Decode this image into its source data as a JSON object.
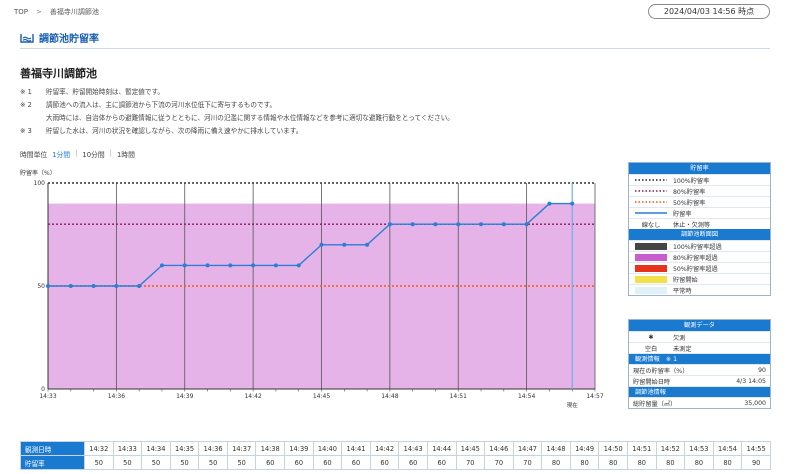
{
  "breadcrumb": {
    "home": "TOP",
    "separator": ">",
    "current": "善福寺川調節池"
  },
  "timestamp": "2024/04/03 14:56 時点",
  "section": {
    "title": "調節池貯留率",
    "icon": "water-gauge-icon"
  },
  "page_title": "善福寺川調節池",
  "notes": [
    {
      "num": "※ 1",
      "lines": [
        "貯留率、貯留開始時刻は、暫定値です。"
      ]
    },
    {
      "num": "※ 2",
      "lines": [
        "調節池への流入は、主に調節池から下流の河川水位低下に寄与するものです。",
        "大雨時には、自治体からの避難情報に従うとともに、河川の氾濫に関する情報や水位情報などを参考に適切な避難行動をとってください。"
      ]
    },
    {
      "num": "※ 3",
      "lines": [
        "貯留した水は、河川の状況を確認しながら、次の降雨に備え速やかに排水しています。"
      ]
    }
  ],
  "time_unit": {
    "label": "時間単位",
    "options": [
      "1分間",
      "10分間",
      "1時間"
    ],
    "selected": "1分間"
  },
  "chart_data": {
    "type": "line",
    "ylabel": "貯留率（%）",
    "ylim": [
      0,
      100
    ],
    "y_ticks": [
      "0",
      "50",
      "100"
    ],
    "x_tick_labels": [
      "14:33",
      "14:36",
      "14:39",
      "14:42",
      "14:45",
      "14:48",
      "14:51",
      "14:54",
      "14:57"
    ],
    "x_range": [
      "14:33",
      "14:57"
    ],
    "now_label": "現在",
    "now_time": "14:56",
    "x": [
      "14:33",
      "14:34",
      "14:35",
      "14:36",
      "14:37",
      "14:38",
      "14:39",
      "14:40",
      "14:41",
      "14:42",
      "14:43",
      "14:44",
      "14:45",
      "14:46",
      "14:47",
      "14:48",
      "14:49",
      "14:50",
      "14:51",
      "14:52",
      "14:53",
      "14:54",
      "14:55",
      "14:56"
    ],
    "values": [
      50,
      50,
      50,
      50,
      50,
      60,
      60,
      60,
      60,
      60,
      60,
      60,
      70,
      70,
      70,
      80,
      80,
      80,
      80,
      80,
      80,
      80,
      90,
      90
    ],
    "reference_lines": [
      {
        "label": "100%貯留率",
        "value": 100,
        "color": "#333333"
      },
      {
        "label": "80%貯留率",
        "value": 80,
        "color": "#8b1a4f"
      },
      {
        "label": "50%貯留率",
        "value": 50,
        "color": "#f05a14"
      }
    ],
    "band": {
      "label": "80%貯留率超過",
      "from": 0,
      "to": 90,
      "color": "#e6b3e8"
    },
    "line_color": "#2a7fd4",
    "grid": true
  },
  "legend": {
    "title": "貯留率",
    "items": [
      {
        "style": "dotted",
        "color": "#222222",
        "label": "100%貯留率"
      },
      {
        "style": "dotted",
        "color": "#8b1a4f",
        "label": "80%貯留率"
      },
      {
        "style": "dotted",
        "color": "#f05a14",
        "label": "50%貯留率"
      },
      {
        "style": "solid",
        "color": "#2a7fd4",
        "label": "貯留率"
      },
      {
        "style": "text",
        "text": "線なし",
        "label": "休止・欠測等"
      }
    ],
    "section_title": "調節池断面図",
    "swatches": [
      {
        "color": "#454545",
        "label": "100%貯留率超過"
      },
      {
        "color": "#c85dcf",
        "label": "80%貯留率超過"
      },
      {
        "color": "#e8331c",
        "label": "50%貯留率超過"
      },
      {
        "color": "#f2e14a",
        "label": "貯留開始"
      },
      {
        "color": "#e0f1f8",
        "label": "平常時"
      }
    ]
  },
  "observation": {
    "title": "観測データ",
    "rows": [
      {
        "symbol": "✱",
        "label": "欠測"
      },
      {
        "symbol": "空白",
        "label": "未測定"
      }
    ],
    "info_title": "観測情報　※ 1",
    "info": [
      {
        "label": "現在の貯留率（%）",
        "value": "90"
      },
      {
        "label": "貯留開始日時",
        "value": "4/3 14:05"
      }
    ],
    "pond_title": "調節池情報",
    "pond": [
      {
        "label": "総貯留量（㎥）",
        "value": "35,000"
      }
    ]
  },
  "table": {
    "time_header": "観測日時",
    "value_header": "貯留率",
    "times": [
      "14:32",
      "14:33",
      "14:34",
      "14:35",
      "14:36",
      "14:37",
      "14:38",
      "14:39",
      "14:40",
      "14:41",
      "14:42",
      "14:43",
      "14:44",
      "14:45",
      "14:46",
      "14:47",
      "14:48",
      "14:49",
      "14:50",
      "14:51",
      "14:52",
      "14:53",
      "14:54",
      "14:55"
    ],
    "values": [
      "50",
      "50",
      "50",
      "50",
      "50",
      "50",
      "60",
      "60",
      "60",
      "60",
      "60",
      "60",
      "60",
      "70",
      "70",
      "70",
      "80",
      "80",
      "80",
      "80",
      "80",
      "80",
      "80",
      "90"
    ]
  }
}
